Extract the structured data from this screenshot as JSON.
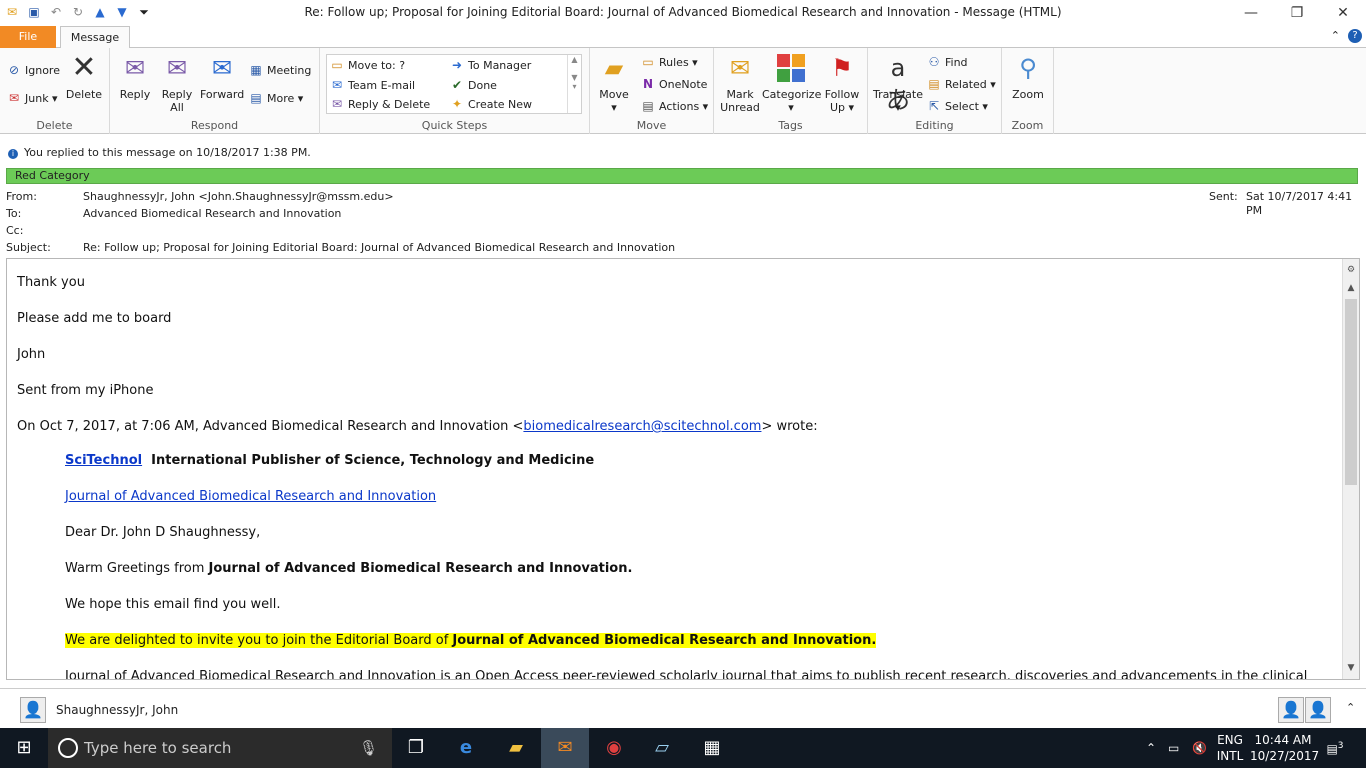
{
  "window": {
    "title": "Re: Follow up; Proposal for Joining Editorial Board: Journal of Advanced Biomedical Research and Innovation  -  Message (HTML)"
  },
  "tabs": {
    "file": "File",
    "message": "Message"
  },
  "ribbon": {
    "delete_group": {
      "ignore": "Ignore",
      "junk": "Junk",
      "delete": "Delete",
      "label": "Delete"
    },
    "respond_group": {
      "reply": "Reply",
      "reply_all_1": "Reply",
      "reply_all_2": "All",
      "forward": "Forward",
      "meeting": "Meeting",
      "more": "More",
      "label": "Respond"
    },
    "quick_steps": {
      "move_to": "Move to: ?",
      "team_email": "Team E-mail",
      "reply_delete": "Reply & Delete",
      "to_manager": "To Manager",
      "done": "Done",
      "create_new": "Create New",
      "label": "Quick Steps"
    },
    "move_group": {
      "move": "Move",
      "rules": "Rules",
      "onenote": "OneNote",
      "actions": "Actions",
      "label": "Move"
    },
    "tags_group": {
      "mark_unread_1": "Mark",
      "mark_unread_2": "Unread",
      "categorize": "Categorize",
      "follow_up_1": "Follow",
      "follow_up_2": "Up",
      "label": "Tags"
    },
    "editing_group": {
      "translate": "Translate",
      "find": "Find",
      "related": "Related",
      "select": "Select",
      "label": "Editing"
    },
    "zoom_group": {
      "zoom": "Zoom",
      "label": "Zoom"
    }
  },
  "info": {
    "replied": "You replied to this message on 10/18/2017 1:38 PM.",
    "category": "Red Category"
  },
  "header": {
    "from_label": "From:",
    "from_value": "ShaughnessyJr, John <John.ShaughnessyJr@mssm.edu>",
    "to_label": "To:",
    "to_value": "Advanced Biomedical Research and Innovation",
    "cc_label": "Cc:",
    "subject_label": "Subject:",
    "subject_value": "Re: Follow up; Proposal for Joining Editorial Board: Journal of Advanced Biomedical Research and Innovation",
    "sent_label": "Sent:",
    "sent_value": "Sat 10/7/2017 4:41 PM"
  },
  "body": {
    "line1": "Thank you",
    "line2": "Please add me to board",
    "line3": "John",
    "line4": "Sent from my iPhone",
    "wrote_prefix": "On Oct 7, 2017, at 7:06 AM, Advanced Biomedical Research and Innovation <",
    "wrote_email": "biomedicalresearch@scitechnol.com",
    "wrote_suffix": "> wrote:",
    "scitechnol_link": "SciTechnol",
    "publisher": "International Publisher of Science, Technology and Medicine",
    "journal_link": "Journal of Advanced Biomedical Research and Innovation",
    "dear": "Dear Dr. John D Shaughnessy,",
    "greet_prefix": "Warm Greetings from ",
    "greet_bold": "Journal of Advanced Biomedical Research and Innovation.",
    "hope": "We hope this email find you well.",
    "invite_prefix": "We are delighted to invite you to join the Editorial Board of ",
    "invite_bold": "Journal of Advanced Biomedical Research and Innovation.",
    "last_line": "Journal of Advanced Biomedical Research and Innovation is an Open Access peer-reviewed scholarly journal that aims to publish recent research, discoveries and advancements in the clinical"
  },
  "people": {
    "name": "ShaughnessyJr, John"
  },
  "taskbar": {
    "search_placeholder": "Type here to search",
    "lang1": "ENG",
    "lang2": "INTL",
    "time": "10:44 AM",
    "date": "10/27/2017",
    "notif_count": "3"
  }
}
